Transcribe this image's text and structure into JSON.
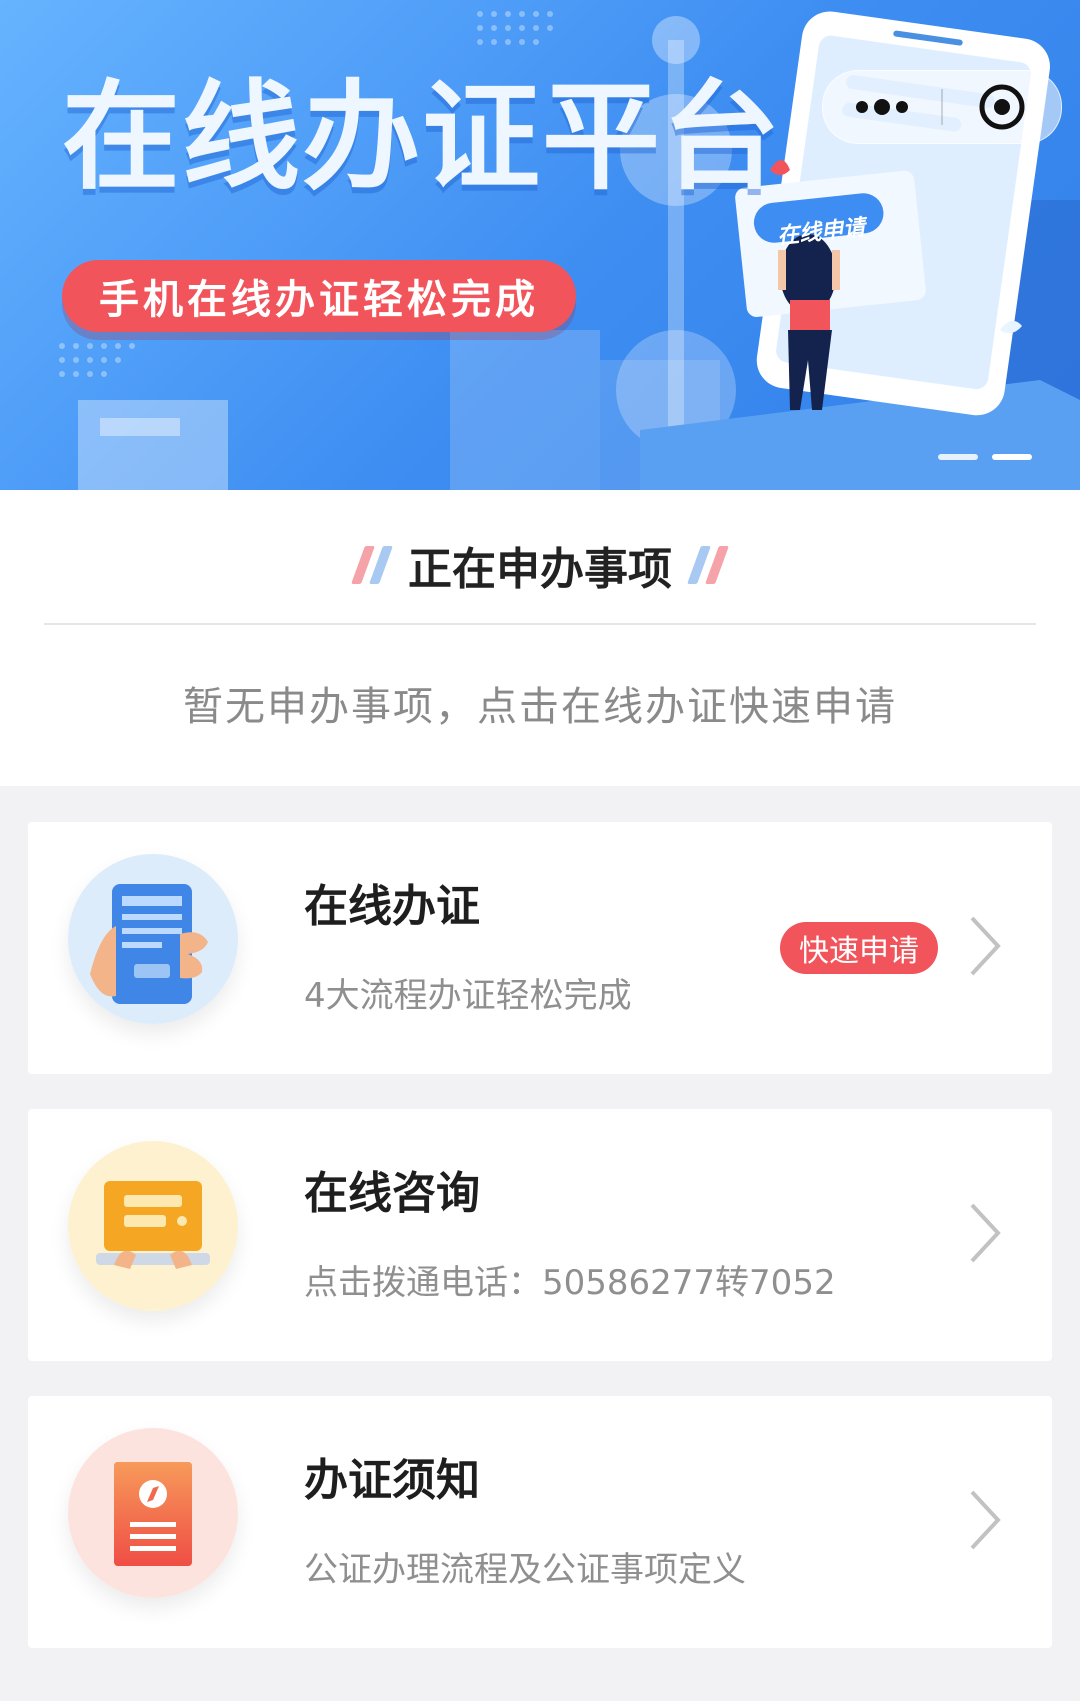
{
  "banner": {
    "title": "在线办证平台",
    "subtitle": "手机在线办证轻松完成",
    "phone_button_label": "在线申请"
  },
  "ongoing": {
    "title": "正在申办事项",
    "empty_message": "暂无申办事项，点击在线办证快速申请"
  },
  "services": [
    {
      "title": "在线办证",
      "subtitle": "4大流程办证轻松完成",
      "badge": "快速申请",
      "icon": "phone-hand-icon"
    },
    {
      "title": "在线咨询",
      "subtitle": "点击拨通电话：50586277转7052",
      "icon": "laptop-chat-icon"
    },
    {
      "title": "办证须知",
      "subtitle": "公证办理流程及公证事项定义",
      "icon": "document-compass-icon"
    }
  ],
  "colors": {
    "accent_red": "#f2545b",
    "banner_blue": "#3d8df2",
    "page_bg": "#f2f2f4"
  }
}
